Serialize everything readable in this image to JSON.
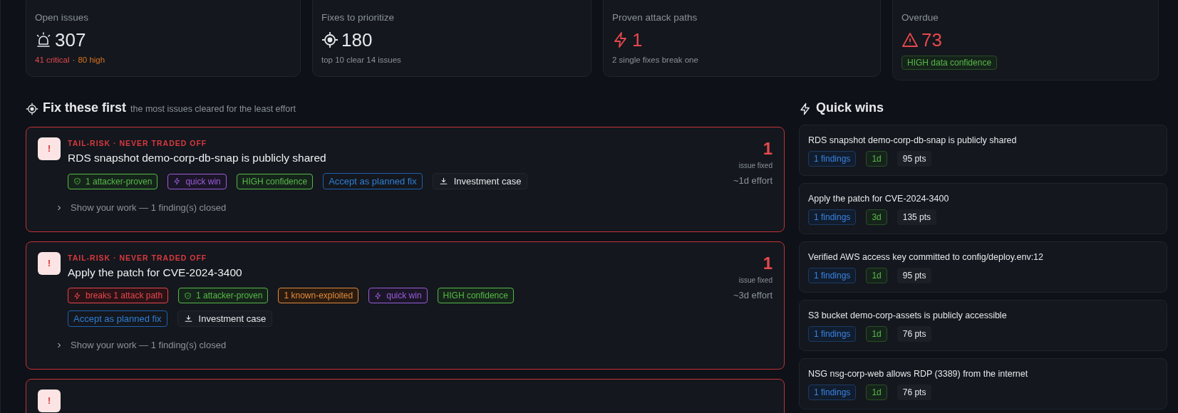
{
  "stats": [
    {
      "kind": "open",
      "label": "Open issues",
      "value": "307",
      "sub": [
        {
          "text": "41 critical",
          "kind": "critical"
        },
        {
          "text": "·",
          "kind": "separator"
        },
        {
          "text": "80 high",
          "kind": "high"
        }
      ]
    },
    {
      "kind": "fixes",
      "label": "Fixes to prioritize",
      "value": "180",
      "sub": [
        {
          "text": "top 10 clear 14 issues",
          "kind": "note"
        }
      ]
    },
    {
      "kind": "paths",
      "label": "Proven attack paths",
      "value": "1",
      "sub": [
        {
          "text": "2 single fixes break one",
          "kind": "note"
        }
      ]
    },
    {
      "kind": "overdue",
      "label": "Overdue",
      "value": "73",
      "badge": "HIGH data confidence"
    }
  ],
  "fixes": {
    "title": "Fix these first",
    "subtitle": "the most issues cleared for the least effort",
    "items": [
      {
        "risk": "TAIL-RISK · NEVER TRADED OFF",
        "icon_glyph": "!",
        "title": "RDS snapshot demo-corp-db-snap is publicly shared",
        "count": "1",
        "count_label": "issue fixed",
        "effort": "~1d effort",
        "tags": [
          {
            "kind": "proven",
            "text": "1 attacker-proven"
          },
          {
            "kind": "quickwin",
            "text": "quick win"
          },
          {
            "kind": "confidence",
            "text": "HIGH confidence"
          }
        ],
        "accept": "Accept as planned fix",
        "investment": "Investment case",
        "details": "Show your work — 1 finding(s) closed",
        "expanded": false
      },
      {
        "risk": "TAIL-RISK · NEVER TRADED OFF",
        "icon_glyph": "!",
        "title": "Apply the patch for CVE-2024-3400",
        "count": "1",
        "count_label": "issue fixed",
        "effort": "~3d effort",
        "tags": [
          {
            "kind": "attack",
            "text": "breaks 1 attack path"
          },
          {
            "kind": "proven",
            "text": "1 attacker-proven"
          },
          {
            "kind": "exploited",
            "text": "1 known-exploited"
          },
          {
            "kind": "quickwin",
            "text": "quick win"
          },
          {
            "kind": "confidence",
            "text": "HIGH confidence"
          }
        ],
        "accept": "Accept as planned fix",
        "investment": "Investment case",
        "details": "Show your work — 1 finding(s) closed",
        "expanded": false
      },
      {
        "icon_glyph": "!"
      }
    ]
  },
  "quick_wins": {
    "title": "Quick wins",
    "items": [
      {
        "title": "RDS snapshot demo-corp-db-snap is publicly shared",
        "findings": "1 findings",
        "effort": "1d",
        "points": "95 pts"
      },
      {
        "title": "Apply the patch for CVE-2024-3400",
        "findings": "1 findings",
        "effort": "3d",
        "points": "135 pts"
      },
      {
        "title": "Verified AWS access key committed to config/deploy.env:12",
        "findings": "1 findings",
        "effort": "1d",
        "points": "95 pts"
      },
      {
        "title": "S3 bucket demo-corp-assets is publicly accessible",
        "findings": "1 findings",
        "effort": "1d",
        "points": "76 pts"
      },
      {
        "title": "NSG nsg-corp-web allows RDP (3389) from the internet",
        "findings": "1 findings",
        "effort": "1d",
        "points": "76 pts"
      }
    ]
  }
}
